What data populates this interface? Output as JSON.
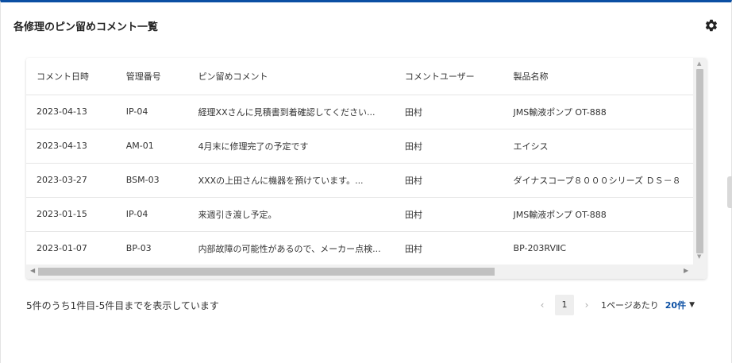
{
  "card": {
    "title": "各修理のピン留めコメント一覧"
  },
  "table": {
    "headers": [
      "コメント日時",
      "管理番号",
      "ピン留めコメント",
      "コメントユーザー",
      "製品名称"
    ],
    "rows": [
      [
        "2023-04-13",
        "IP-04",
        "経理XXさんに見積書到着確認してください...",
        "田村",
        "JMS輸液ポンプ OT-888"
      ],
      [
        "2023-04-13",
        "AM-01",
        "4月末に修理完了の予定です",
        "田村",
        "エイシス"
      ],
      [
        "2023-03-27",
        "BSM-03",
        "XXXの上田さんに機器を預けています。...",
        "田村",
        "ダイナスコープ８０００シリーズ ＤＳ－８"
      ],
      [
        "2023-01-15",
        "IP-04",
        "来週引き渡し予定。",
        "田村",
        "JMS輸液ポンプ OT-888"
      ],
      [
        "2023-01-07",
        "BP-03",
        "内部故障の可能性があるので、メーカー点検...",
        "田村",
        "BP-203RVⅡC"
      ]
    ]
  },
  "footer": {
    "summary": "5件のうち1件目-5件目までを表示しています",
    "current_page": "1",
    "per_page_label": "1ページあたり",
    "per_page_value": "20件"
  }
}
